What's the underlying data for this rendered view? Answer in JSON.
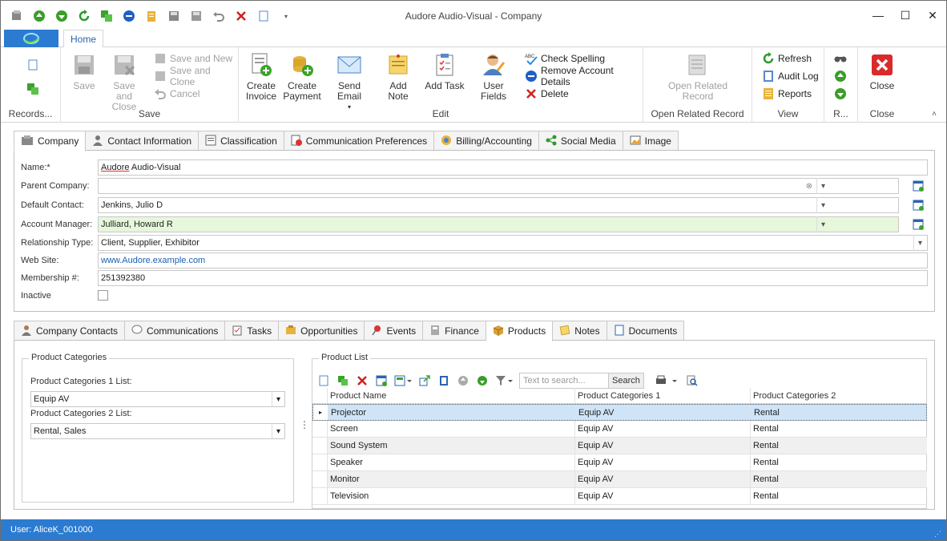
{
  "window": {
    "title": "Audore Audio-Visual - Company",
    "controls": [
      "minimize-icon",
      "maximize-icon",
      "close-icon"
    ]
  },
  "ribbon": {
    "tab": "Home",
    "groups": {
      "records": {
        "label": "Records..."
      },
      "save": {
        "label": "Save",
        "save": "Save",
        "save_close": [
          "Save and",
          "Close"
        ],
        "save_new": "Save and New",
        "save_clone": "Save and Clone",
        "cancel": "Cancel"
      },
      "edit": {
        "label": "Edit",
        "create_invoice": [
          "Create",
          "Invoice"
        ],
        "create_payment": [
          "Create",
          "Payment"
        ],
        "send_email": "Send Email",
        "add_note": "Add Note",
        "add_task": "Add Task",
        "user_fields": "User Fields",
        "check_spelling": "Check Spelling",
        "remove_details": "Remove Account Details",
        "delete": "Delete"
      },
      "related": {
        "label": "Open Related Record",
        "open": [
          "Open Related",
          "Record"
        ]
      },
      "view": {
        "label": "View",
        "refresh": "Refresh",
        "audit_log": "Audit Log",
        "reports": "Reports"
      },
      "r": {
        "label": "R..."
      },
      "close": {
        "label": "Close",
        "close": "Close"
      }
    }
  },
  "form_tabs": [
    "Company",
    "Contact Information",
    "Classification",
    "Communication Preferences",
    "Billing/Accounting",
    "Social Media",
    "Image"
  ],
  "form": {
    "name_label": "Name:*",
    "name_value_a": "Audore",
    "name_value_b": " Audio-Visual",
    "parent_label": "Parent Company:",
    "parent_value": "",
    "default_contact_label": "Default Contact:",
    "default_contact_value": "Jenkins, Julio D",
    "account_manager_label": "Account Manager:",
    "account_manager_value": "Julliard, Howard R",
    "relationship_label": "Relationship Type:",
    "relationship_value": "Client, Supplier, Exhibitor",
    "website_label": "Web Site:",
    "website_value": "www.Audore.example.com",
    "membership_label": "Membership #:",
    "membership_value": "251392380",
    "inactive_label": "Inactive"
  },
  "detail_tabs": [
    "Company Contacts",
    "Communications",
    "Tasks",
    "Opportunities",
    "Events",
    "Finance",
    "Products",
    "Notes",
    "Documents"
  ],
  "product_categories": {
    "title": "Product Categories",
    "list1_label": "Product Categories 1 List:",
    "list1_value": "Equip AV",
    "list2_label": "Product Categories 2 List:",
    "list2_value": "Rental, Sales"
  },
  "product_list": {
    "title": "Product List",
    "search_placeholder": "Text to search...",
    "search_button": "Search",
    "columns": [
      "Product Name",
      "Product Categories 1",
      "Product Categories 2"
    ],
    "rows": [
      [
        "Projector",
        "Equip AV",
        "Rental"
      ],
      [
        "Screen",
        "Equip AV",
        "Rental"
      ],
      [
        "Sound System",
        "Equip AV",
        "Rental"
      ],
      [
        "Speaker",
        "Equip AV",
        "Rental"
      ],
      [
        "Monitor",
        "Equip AV",
        "Rental"
      ],
      [
        "Television",
        "Equip AV",
        "Rental"
      ]
    ]
  },
  "status": {
    "user": "User: AliceK_001000"
  },
  "colors": {
    "accent": "#2b7bd0",
    "green_field": "#e6f7dc",
    "selected_row": "#cfe4f7"
  }
}
